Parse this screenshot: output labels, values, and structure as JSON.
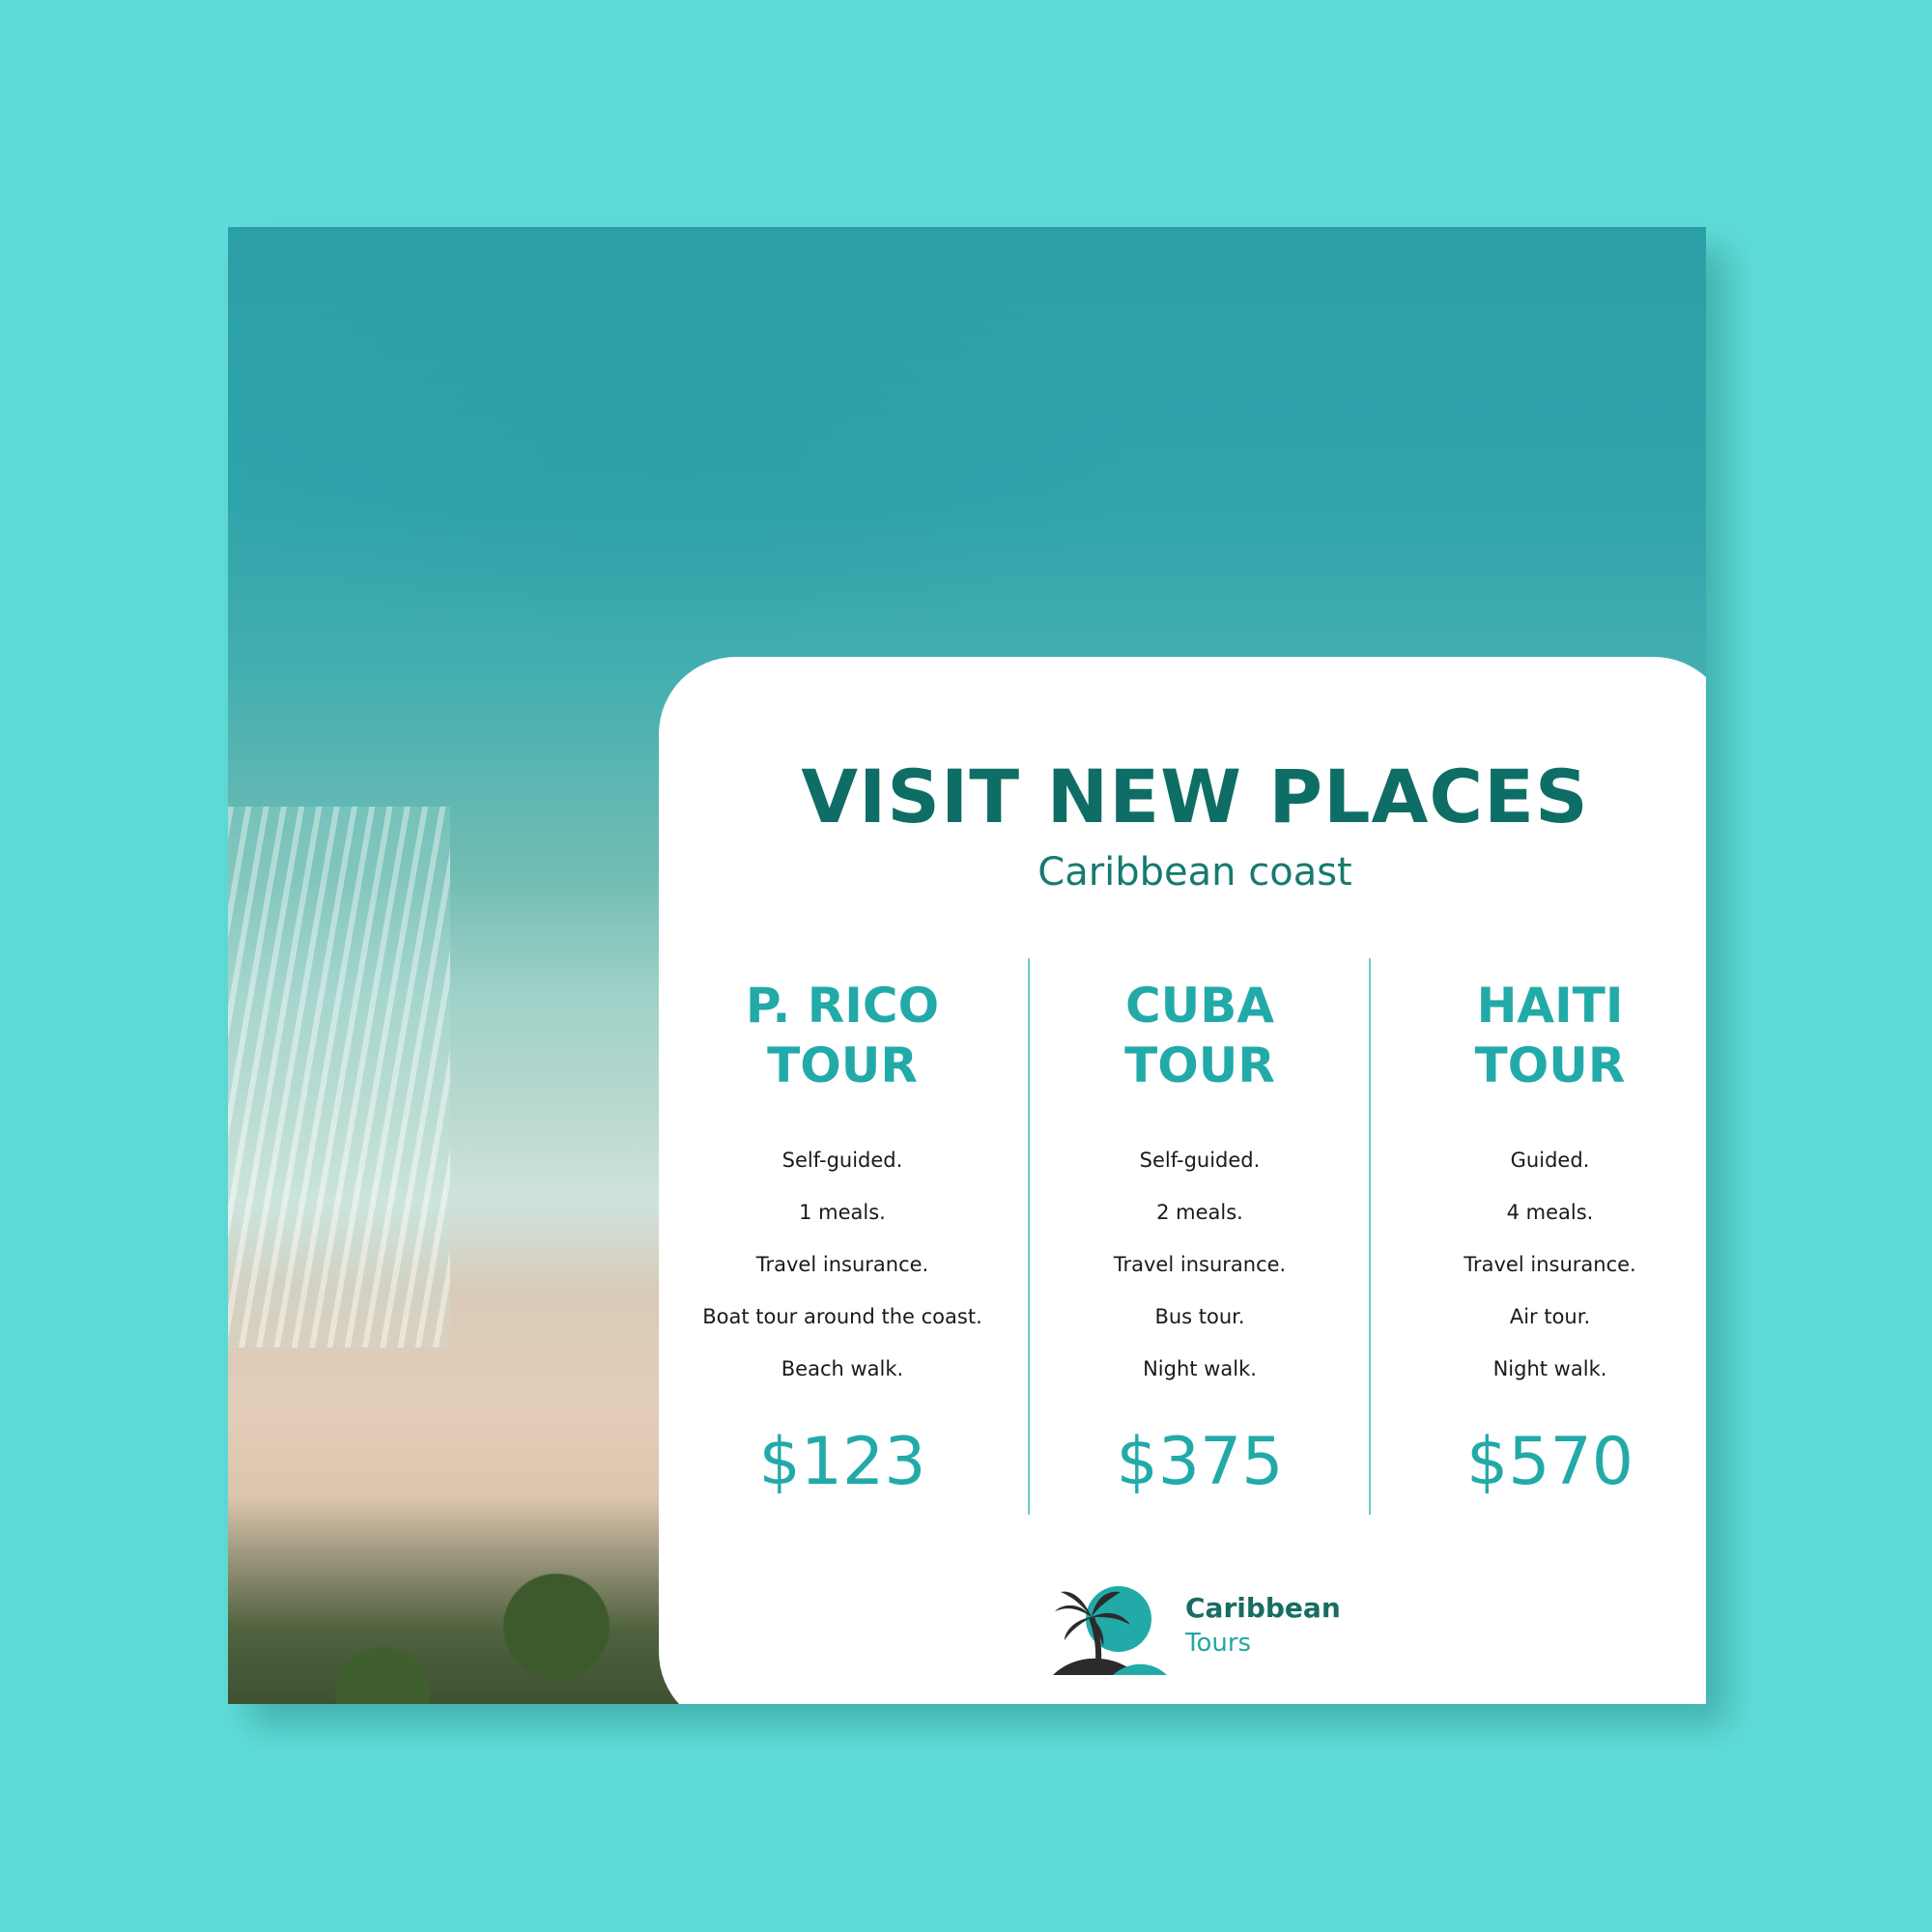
{
  "headline": "VISIT NEW PLACES",
  "subheadline": "Caribbean coast",
  "tours": [
    {
      "name_line1": "P. RICO",
      "name_line2": "TOUR",
      "features": [
        "Self-guided.",
        "1 meals.",
        "Travel insurance.",
        "Boat tour around the coast.",
        "Beach walk."
      ],
      "price": "$123"
    },
    {
      "name_line1": "CUBA",
      "name_line2": "TOUR",
      "features": [
        "Self-guided.",
        "2 meals.",
        "Travel insurance.",
        "Bus tour.",
        "Night walk."
      ],
      "price": "$375"
    },
    {
      "name_line1": "HAITI",
      "name_line2": "TOUR",
      "features": [
        "Guided.",
        "4 meals.",
        "Travel insurance.",
        "Air tour.",
        "Night walk."
      ],
      "price": "$570"
    }
  ],
  "brand": {
    "name": "Caribbean",
    "tagline": "Tours",
    "icon": "palm-island-sun-icon"
  },
  "colors": {
    "page_background": "#5fdcd9",
    "headline": "#0e6e66",
    "accent": "#22aaa9",
    "card": "#ffffff"
  }
}
